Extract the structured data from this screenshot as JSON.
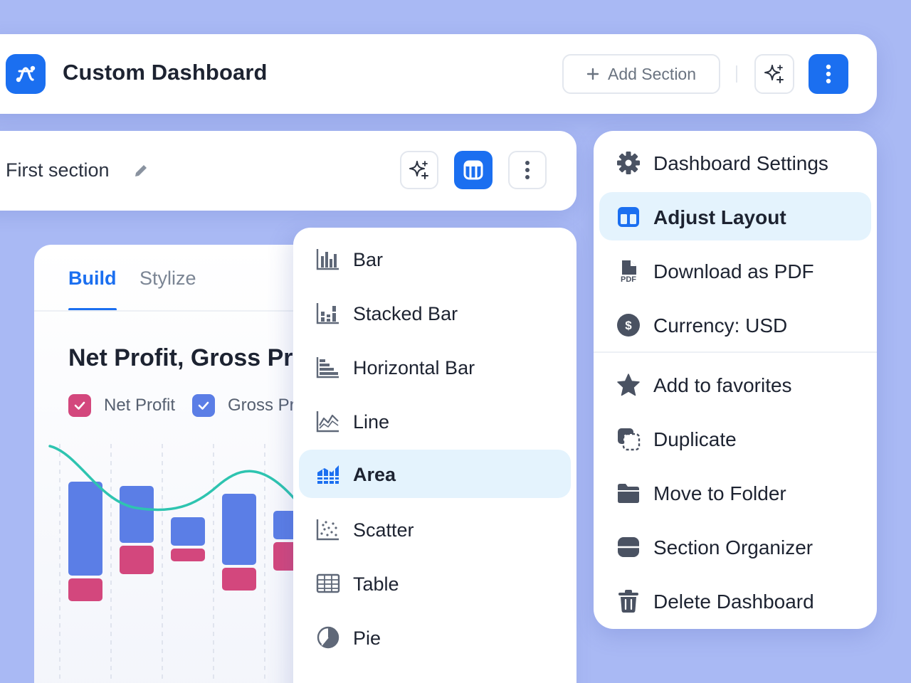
{
  "header": {
    "title": "Custom Dashboard",
    "add_section_label": "Add Section"
  },
  "section": {
    "title": "First section"
  },
  "builder": {
    "tabs": [
      {
        "label": "Build",
        "active": true
      },
      {
        "label": "Stylize",
        "active": false
      }
    ],
    "chart_title": "Net Profit, Gross Pr",
    "legend": [
      {
        "label": "Net Profit",
        "color": "#d3477d",
        "checked": true
      },
      {
        "label": "Gross Pr",
        "color": "#5b7ee6",
        "checked": true
      }
    ]
  },
  "chart_data": {
    "type": "bar",
    "series": [
      {
        "color": "#5b7ee6",
        "values": [
          66,
          40,
          20,
          50,
          20
        ]
      },
      {
        "color": "#d3477d",
        "values": [
          16,
          20,
          9,
          16,
          20
        ]
      },
      {
        "color": "#2ec4b0",
        "values": [
          75,
          60,
          52,
          72,
          60
        ]
      }
    ]
  },
  "chart_types": {
    "selected": "Area",
    "items": [
      {
        "label": "Bar",
        "icon": "bar-chart-icon"
      },
      {
        "label": "Stacked Bar",
        "icon": "stacked-bar-icon"
      },
      {
        "label": "Horizontal Bar",
        "icon": "horizontal-bar-icon"
      },
      {
        "label": "Line",
        "icon": "line-chart-icon"
      },
      {
        "label": "Area",
        "icon": "area-chart-icon"
      },
      {
        "label": "Scatter",
        "icon": "scatter-chart-icon"
      },
      {
        "label": "Table",
        "icon": "table-icon"
      },
      {
        "label": "Pie",
        "icon": "pie-chart-icon"
      }
    ]
  },
  "menu": {
    "selected": "Adjust Layout",
    "items": [
      {
        "label": "Dashboard Settings",
        "icon": "gear-icon"
      },
      {
        "label": "Adjust Layout",
        "icon": "layout-icon"
      },
      {
        "label": "Download as PDF",
        "icon": "pdf-file-icon"
      },
      {
        "label": "Currency: USD",
        "icon": "dollar-icon"
      },
      {
        "label": "Add to favorites",
        "icon": "star-icon"
      },
      {
        "label": "Duplicate",
        "icon": "duplicate-icon"
      },
      {
        "label": "Move to Folder",
        "icon": "folder-icon"
      },
      {
        "label": "Section Organizer",
        "icon": "section-organizer-icon"
      },
      {
        "label": "Delete Dashboard",
        "icon": "trash-icon"
      }
    ]
  },
  "colors": {
    "accent": "#1b6ff0",
    "background": "#a9b9f4",
    "selected_row": "#e4f3fd"
  }
}
